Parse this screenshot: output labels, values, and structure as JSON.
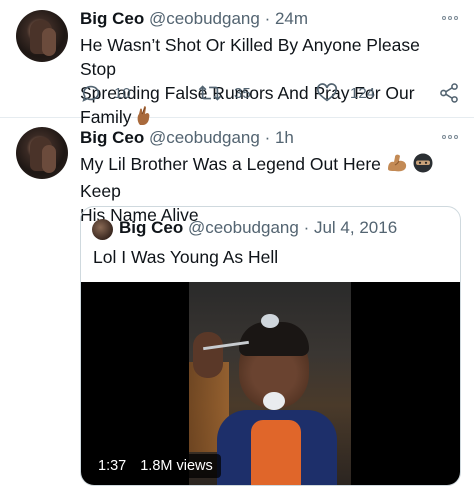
{
  "tweets": [
    {
      "name": "Big Ceo",
      "handle": "@ceobudgang",
      "separator": "·",
      "time": "24m",
      "text_line1": "He Wasn’t Shot Or Killed By Anyone Please Stop",
      "text_line2": "Spreading False Rumors And Pray For Our Family",
      "emoji_end": "crossed-fingers-emoji",
      "stats": {
        "replies": "10",
        "retweets": "35",
        "likes": "124"
      }
    },
    {
      "name": "Big Ceo",
      "handle": "@ceobudgang",
      "separator": "·",
      "time": "1h",
      "text_line1_a": "My Lil Brother Was a Legend Out Here",
      "emojis": [
        "flexed-biceps-emoji",
        "ninja-mask-emoji"
      ],
      "text_line1_b": "Keep",
      "text_line2": "His Name Alive",
      "quote": {
        "name": "Big Ceo",
        "handle": "@ceobudgang",
        "separator": "·",
        "date": "Jul 4, 2016",
        "text": "Lol I Was Young As Hell",
        "video": {
          "duration": "1:37",
          "views": "1.8M views"
        }
      }
    }
  ],
  "icons": {
    "more": "more-options-icon",
    "reply": "reply-icon",
    "retweet": "retweet-icon",
    "like": "like-icon",
    "share": "share-icon"
  },
  "colors": {
    "text": "#0f1419",
    "secondary": "#536471",
    "border": "#cfd9de",
    "divider": "#e6ecf0"
  }
}
